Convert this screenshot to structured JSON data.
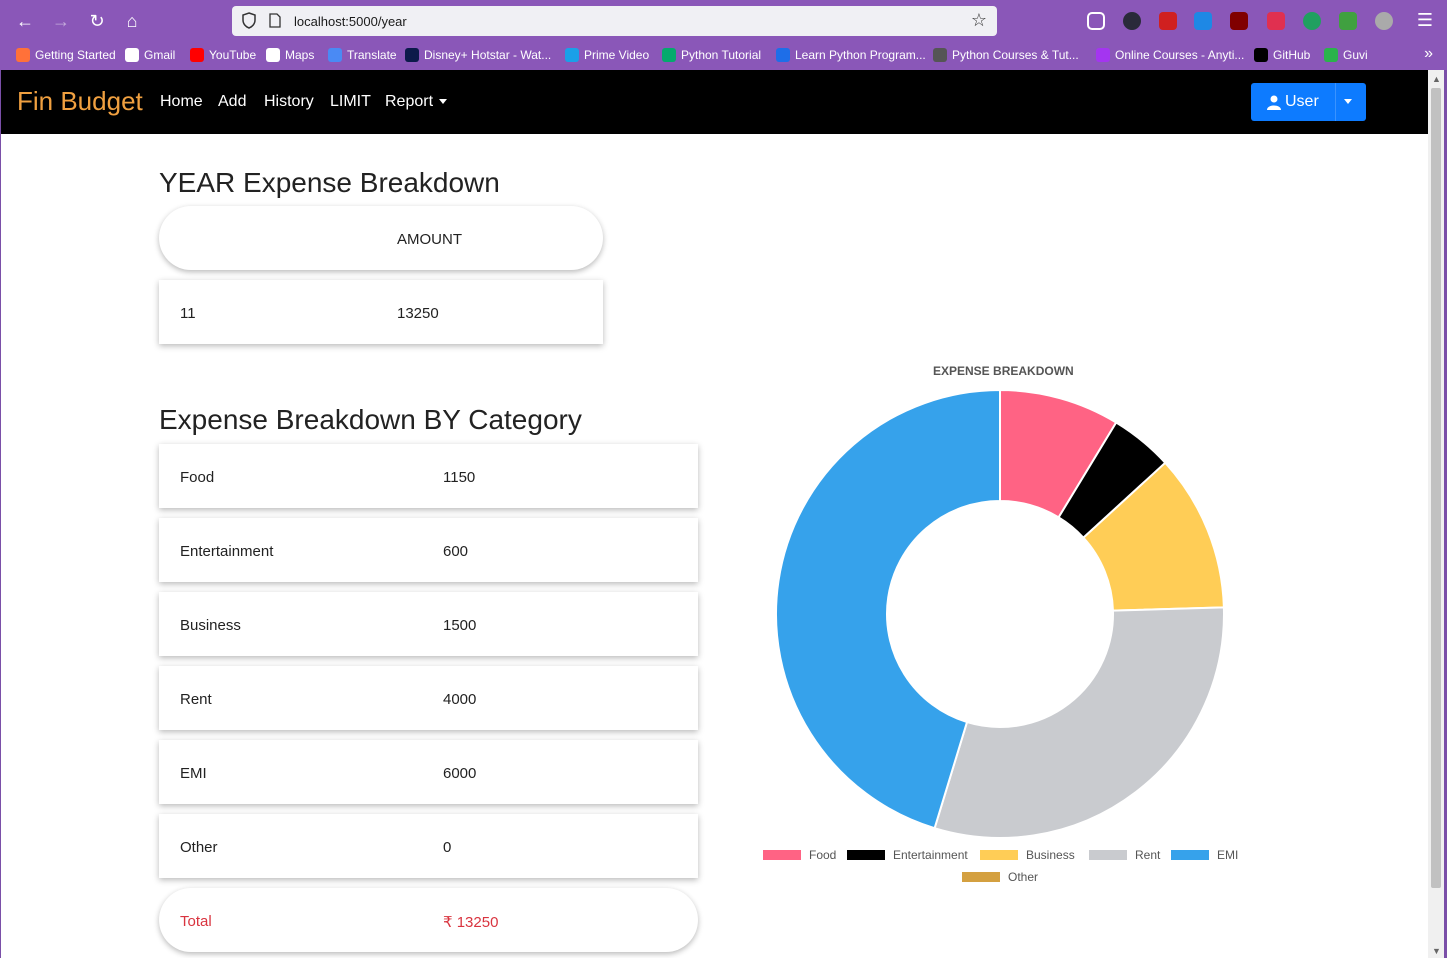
{
  "browser": {
    "url": "localhost:5000/year",
    "bookmarks": [
      {
        "label": "Getting Started",
        "color": "#ff7139"
      },
      {
        "label": "Gmail",
        "color": "#ffffff"
      },
      {
        "label": "YouTube",
        "color": "#ff0000"
      },
      {
        "label": "Maps",
        "color": "#ffffff"
      },
      {
        "label": "Translate",
        "color": "#4a8af4"
      },
      {
        "label": "Disney+ Hotstar - Wat...",
        "color": "#0c1a4a"
      },
      {
        "label": "Prime Video",
        "color": "#1aa0e8"
      },
      {
        "label": "Python Tutorial",
        "color": "#04aa6d"
      },
      {
        "label": "Learn Python Program...",
        "color": "#1e6ee8"
      },
      {
        "label": "Python Courses & Tut...",
        "color": "#555555"
      },
      {
        "label": "Online Courses - Anyti...",
        "color": "#a435f0"
      },
      {
        "label": "GitHub",
        "color": "#000000"
      },
      {
        "label": "Guvi",
        "color": "#2ab34b"
      }
    ]
  },
  "navbar": {
    "brand": "Fin Budget",
    "links": [
      "Home",
      "Add",
      "History",
      "LIMIT"
    ],
    "report": "Report",
    "user": "User"
  },
  "year_section": {
    "title": "YEAR Expense Breakdown",
    "header_col2": "AMOUNT",
    "row": {
      "col1": "11",
      "col2": "13250"
    }
  },
  "category_section": {
    "title": "Expense Breakdown BY Category",
    "rows": [
      {
        "name": "Food",
        "amount": "1150"
      },
      {
        "name": "Entertainment",
        "amount": "600"
      },
      {
        "name": "Business",
        "amount": "1500"
      },
      {
        "name": "Rent",
        "amount": "4000"
      },
      {
        "name": "EMI",
        "amount": "6000"
      },
      {
        "name": "Other",
        "amount": "0"
      }
    ],
    "total_label": "Total",
    "total_amount": "₹ 13250"
  },
  "chart_data": {
    "type": "pie",
    "title": "EXPENSE BREAKDOWN",
    "categories": [
      "Food",
      "Entertainment",
      "Business",
      "Rent",
      "EMI",
      "Other"
    ],
    "values": [
      1150,
      600,
      1500,
      4000,
      6000,
      0
    ],
    "colors": [
      "#ff6384",
      "#000000",
      "#ffcd56",
      "#c9cbcf",
      "#36a2eb",
      "#d4a040"
    ],
    "legend": "bottom"
  }
}
